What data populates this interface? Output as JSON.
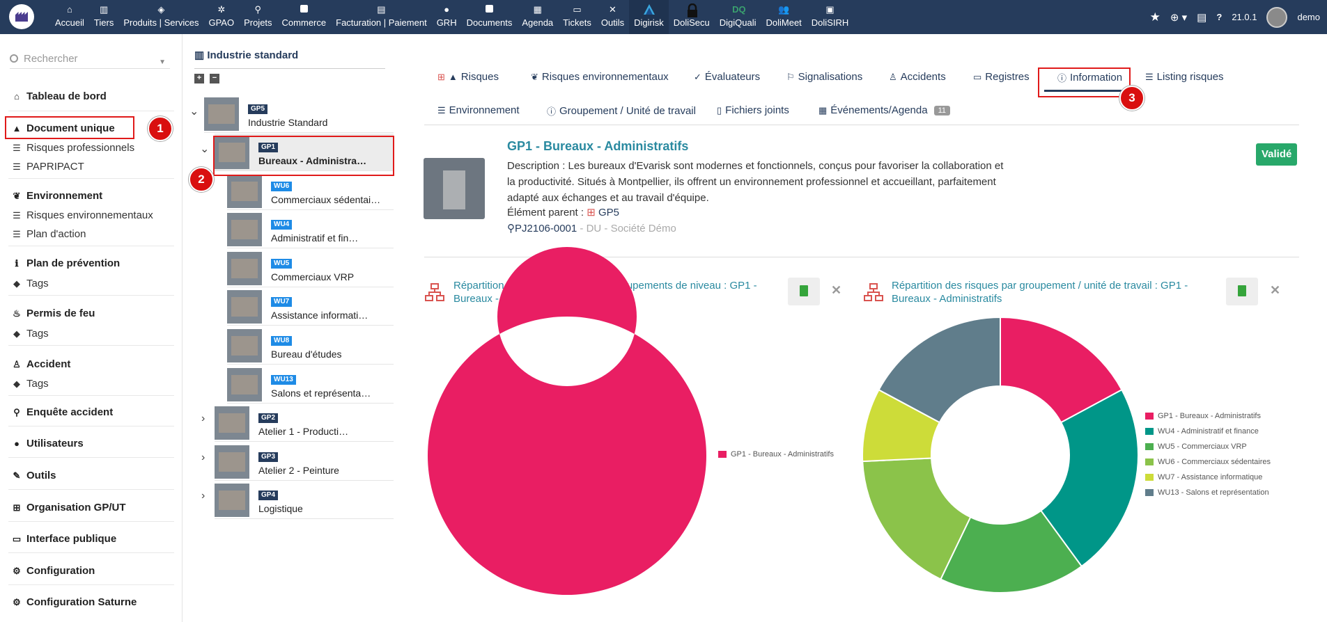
{
  "topbar": {
    "menu": [
      {
        "label": "Accueil",
        "icon": "house-icon"
      },
      {
        "label": "Tiers",
        "icon": "building-icon"
      },
      {
        "label": "Produits | Services",
        "icon": "cube-icon"
      },
      {
        "label": "GPAO",
        "icon": "cogs-icon"
      },
      {
        "label": "Projets",
        "icon": "project-icon"
      },
      {
        "label": "Commerce",
        "icon": "briefcase-icon"
      },
      {
        "label": "Facturation | Paiement",
        "icon": "invoice-icon"
      },
      {
        "label": "GRH",
        "icon": "user-icon"
      },
      {
        "label": "Documents",
        "icon": "folder-icon"
      },
      {
        "label": "Agenda",
        "icon": "calendar-icon"
      },
      {
        "label": "Tickets",
        "icon": "ticket-icon"
      },
      {
        "label": "Outils",
        "icon": "tools-icon"
      },
      {
        "label": "Digirisk",
        "icon": "digirisk-logo-icon"
      },
      {
        "label": "DoliSecu",
        "icon": "lock-icon"
      },
      {
        "label": "DigiQuali",
        "icon": "digiquali-logo-icon"
      },
      {
        "label": "DoliMeet",
        "icon": "meeting-icon"
      },
      {
        "label": "DoliSIRH",
        "icon": "id-card-icon"
      }
    ],
    "version": "21.0.1",
    "user": "demo"
  },
  "sidebar": {
    "search_placeholder": "Rechercher",
    "items": [
      {
        "label": "Tableau de bord",
        "type": "head",
        "icon": "home-icon"
      },
      {
        "label": "Document unique",
        "type": "head",
        "icon": "warning-icon"
      },
      {
        "label": "Risques professionnels",
        "type": "sub",
        "icon": "list-icon"
      },
      {
        "label": "PAPRIPACT",
        "type": "sub",
        "icon": "list-check-icon"
      },
      {
        "label": "Environnement",
        "type": "head",
        "icon": "leaf-icon"
      },
      {
        "label": "Risques environnementaux",
        "type": "sub",
        "icon": "list-icon"
      },
      {
        "label": "Plan d'action",
        "type": "sub",
        "icon": "list-check-icon"
      },
      {
        "label": "Plan de prévention",
        "type": "head",
        "icon": "info-icon"
      },
      {
        "label": "Tags",
        "type": "sub",
        "icon": "tags-icon"
      },
      {
        "label": "Permis de feu",
        "type": "head",
        "icon": "fire-icon"
      },
      {
        "label": "Tags",
        "type": "sub",
        "icon": "tags-icon"
      },
      {
        "label": "Accident",
        "type": "head",
        "icon": "person-injured-icon"
      },
      {
        "label": "Tags",
        "type": "sub",
        "icon": "tags-icon"
      },
      {
        "label": "Enquête accident",
        "type": "head",
        "icon": "search-icon"
      },
      {
        "label": "Utilisateurs",
        "type": "head",
        "icon": "user-icon"
      },
      {
        "label": "Outils",
        "type": "head",
        "icon": "wrench-icon"
      },
      {
        "label": "Organisation GP/UT",
        "type": "head",
        "icon": "network-icon"
      },
      {
        "label": "Interface publique",
        "type": "head",
        "icon": "ticket-icon"
      },
      {
        "label": "Configuration",
        "type": "head",
        "icon": "gear-icon"
      },
      {
        "label": "Configuration Saturne",
        "type": "head",
        "icon": "gear-icon"
      }
    ]
  },
  "annotations": [
    "1",
    "2",
    "3"
  ],
  "tree": {
    "title": "Industrie standard",
    "nodes": [
      {
        "tag": "GP5",
        "label": "Industrie Standard",
        "kind": "gp"
      },
      {
        "tag": "GP1",
        "label": "Bureaux - Administra…",
        "kind": "gp"
      },
      {
        "tag": "WU6",
        "label": "Commerciaux sédentai…",
        "kind": "wu"
      },
      {
        "tag": "WU4",
        "label": "Administratif et fin…",
        "kind": "wu"
      },
      {
        "tag": "WU5",
        "label": "Commerciaux VRP",
        "kind": "wu"
      },
      {
        "tag": "WU7",
        "label": "Assistance informati…",
        "kind": "wu"
      },
      {
        "tag": "WU8",
        "label": "Bureau d'études",
        "kind": "wu"
      },
      {
        "tag": "WU13",
        "label": "Salons et représenta…",
        "kind": "wu"
      },
      {
        "tag": "GP2",
        "label": "Atelier 1 - Producti…",
        "kind": "gp"
      },
      {
        "tag": "GP3",
        "label": "Atelier 2 - Peinture",
        "kind": "gp"
      },
      {
        "tag": "GP4",
        "label": "Logistique",
        "kind": "gp"
      }
    ]
  },
  "tabs": {
    "row1": [
      {
        "label": "Risques",
        "icon": "warning-icon"
      },
      {
        "label": "Risques environnementaux",
        "icon": "leaf-icon"
      },
      {
        "label": "Évaluateurs",
        "icon": "user-check-icon"
      },
      {
        "label": "Signalisations",
        "icon": "signs-icon"
      },
      {
        "label": "Accidents",
        "icon": "person-injured-icon"
      },
      {
        "label": "Registres",
        "icon": "ticket-icon"
      },
      {
        "label": "Information",
        "icon": "info-circle-icon"
      },
      {
        "label": "Listing risques",
        "icon": "list-icon"
      }
    ],
    "row2": [
      {
        "label": "Environnement",
        "icon": "list-icon"
      },
      {
        "label": "Groupement / Unité de travail",
        "icon": "info-circle-icon"
      },
      {
        "label": "Fichiers joints",
        "icon": "file-icon"
      },
      {
        "label": "Événements/Agenda",
        "icon": "calendar-icon",
        "count": "11"
      }
    ]
  },
  "object": {
    "title": "GP1 - Bureaux - Administratifs",
    "description": "Description : Les bureaux d'Evarisk sont modernes et fonctionnels, conçus pour favoriser la collaboration et la productivité. Situés à Montpellier, ils offrent un environnement professionnel et accueillant, parfaitement adapté aux échanges et au travail d'équipe.",
    "parent_label": "Élément parent :",
    "parent_value": "GP5",
    "ref": "PJ2106-0001",
    "ref_suffix": "- DU - Société Démo",
    "status": "Validé"
  },
  "colors": {
    "topbar": "#263c5c",
    "accent": "#2a8aa0",
    "status": "#28a86a",
    "annot": "#d90f0f"
  },
  "chart_data": [
    {
      "type": "pie",
      "title": "Répartition de l'arborescence des groupements de niveau : GP1 - Bureaux - Administratifs",
      "categories": [
        "GP1 - Bureaux - Administratifs"
      ],
      "values": [
        1
      ],
      "colors": [
        "#e91e63"
      ],
      "legend": "right"
    },
    {
      "type": "pie",
      "title": "Répartition des risques par groupement / unité de travail : GP1 - Bureaux - Administratifs",
      "categories": [
        "GP1 - Bureaux - Administratifs",
        "WU4 - Administratif et finance",
        "WU5 - Commerciaux VRP",
        "WU6 - Commerciaux sédentaires",
        "WU7 - Assistance informatique",
        "WU13 - Salons et représentation"
      ],
      "values": [
        1,
        1.33,
        1,
        1,
        0.5,
        1
      ],
      "colors": [
        "#e91e63",
        "#009688",
        "#4caf50",
        "#8bc34a",
        "#cddc39",
        "#607d8b"
      ],
      "legend": "right"
    }
  ]
}
